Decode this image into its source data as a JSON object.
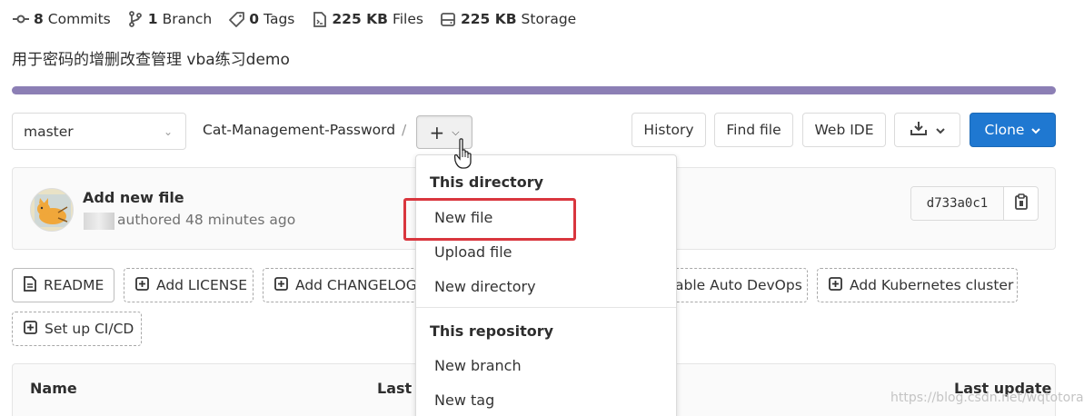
{
  "stats": [
    {
      "icon": "commit-icon",
      "count": "8",
      "label": "Commits"
    },
    {
      "icon": "branch-icon",
      "count": "1",
      "label": "Branch"
    },
    {
      "icon": "tag-icon",
      "count": "0",
      "label": "Tags"
    },
    {
      "icon": "file-icon",
      "count": "225 KB",
      "label": "Files"
    },
    {
      "icon": "storage-icon",
      "count": "225 KB",
      "label": "Storage"
    }
  ],
  "description": "用于密码的增删改查管理 vba练习demo",
  "language_bar": {
    "color": "#8c7fb5",
    "fraction": 1.0
  },
  "toolbar": {
    "branch": "master",
    "repo_path": "Cat-Management-Password",
    "separator": "/",
    "plus_label": "+",
    "history": "History",
    "find_file": "Find file",
    "web_ide": "Web IDE",
    "clone": "Clone"
  },
  "commit": {
    "title": "Add new file",
    "meta": "authored 48 minutes ago",
    "sha": "d733a0c1"
  },
  "quick_actions": {
    "readme": "README",
    "license": "Add LICENSE",
    "changelog": "Add CHANGELOG",
    "autodevops": "able Auto DevOps",
    "kubernetes": "Add Kubernetes cluster",
    "cicd": "Set up CI/CD"
  },
  "table": {
    "name": "Name",
    "last_commit": "Last c",
    "last_update": "Last update"
  },
  "dropdown": {
    "section1": "This directory",
    "new_file": "New file",
    "upload_file": "Upload file",
    "new_directory": "New directory",
    "section2": "This repository",
    "new_branch": "New branch",
    "new_tag": "New tag"
  },
  "colors": {
    "clone": "#1f78d1",
    "highlight": "#d9363e"
  },
  "watermark": "https://blog.csdn.net/wqtotora"
}
